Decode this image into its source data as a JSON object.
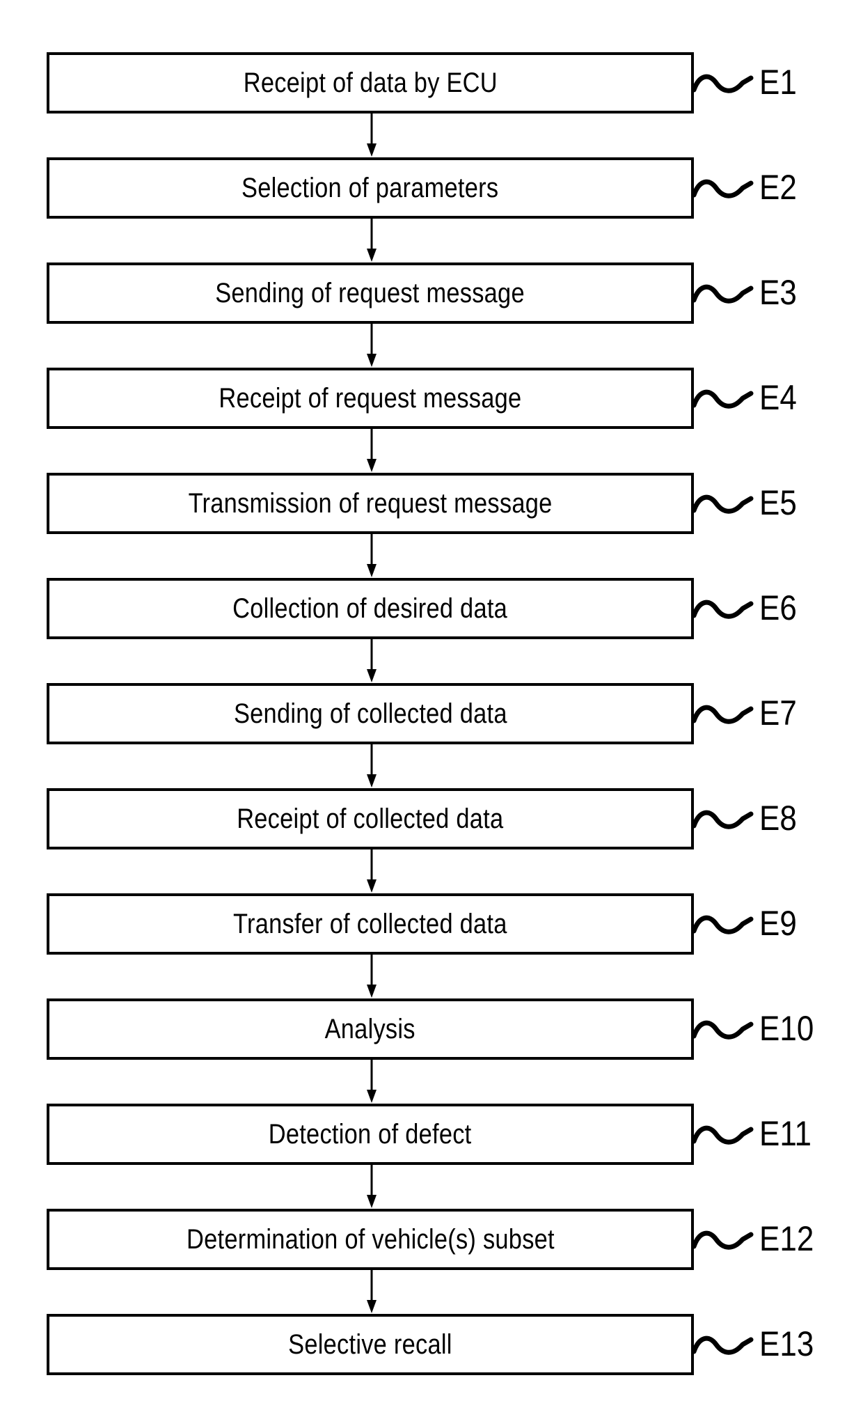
{
  "figure": {
    "type": "process-flowchart",
    "orientation": "vertical",
    "background_color": "#ffffff",
    "line_color": "#000000",
    "connector_icon": "down-arrow-icon",
    "leader_icon": "squiggle-leader-icon",
    "steps": [
      {
        "ref": "E1",
        "label": "Receipt of data by ECU"
      },
      {
        "ref": "E2",
        "label": "Selection of parameters"
      },
      {
        "ref": "E3",
        "label": "Sending of request message"
      },
      {
        "ref": "E4",
        "label": "Receipt of request message"
      },
      {
        "ref": "E5",
        "label": "Transmission of request message"
      },
      {
        "ref": "E6",
        "label": "Collection of desired data"
      },
      {
        "ref": "E7",
        "label": "Sending of collected data"
      },
      {
        "ref": "E8",
        "label": "Receipt of collected data"
      },
      {
        "ref": "E9",
        "label": "Transfer of collected data"
      },
      {
        "ref": "E10",
        "label": "Analysis"
      },
      {
        "ref": "E11",
        "label": "Detection of defect"
      },
      {
        "ref": "E12",
        "label": "Determination of vehicle(s) subset"
      },
      {
        "ref": "E13",
        "label": "Selective recall"
      }
    ]
  }
}
